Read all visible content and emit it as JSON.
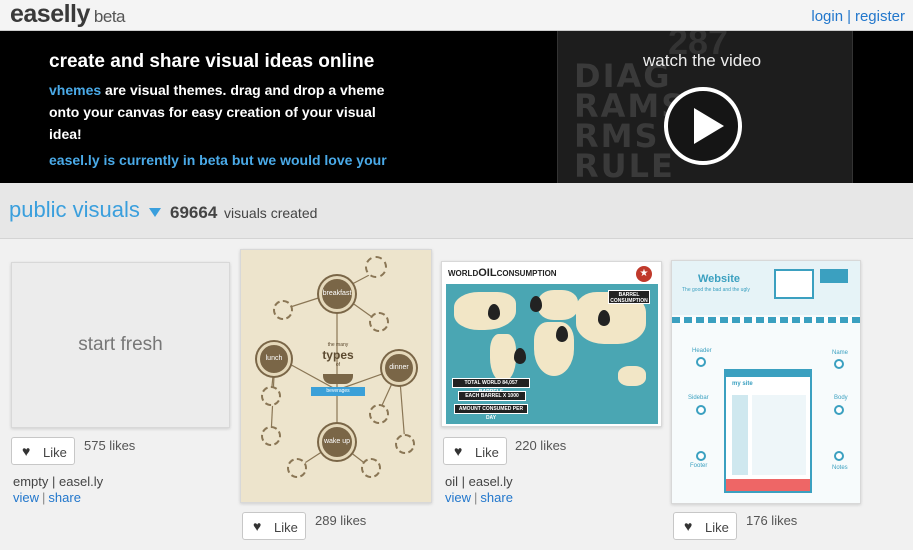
{
  "header": {
    "logo_text": "easelly",
    "beta_label": "beta",
    "login": "login",
    "separator": "|",
    "register": "register"
  },
  "hero": {
    "title": "create and share visual ideas online",
    "vhemes_word": "vhemes",
    "desc_rest": " are visual themes. drag and drop a vheme onto your canvas for easy creation of your visual idea!",
    "beta_note": "easel.ly is currently in beta but we would love your",
    "video_label": "watch the video"
  },
  "section": {
    "title": "public visuals",
    "count": "69664",
    "count_suffix": "visuals created"
  },
  "cards": [
    {
      "thumb_text": "start fresh",
      "like_label": "Like",
      "likes": "575 likes",
      "meta": "empty | easel.ly",
      "view": "view",
      "share": "share",
      "sep": "|"
    },
    {
      "like_label": "Like",
      "likes": "289 likes"
    },
    {
      "like_label": "Like",
      "likes": "220 likes",
      "meta": "oil | easel.ly",
      "view": "view",
      "share": "share",
      "sep": "|"
    },
    {
      "like_label": "Like",
      "likes": "176 likes"
    }
  ],
  "thumb_bev": {
    "center_line1": "the many",
    "center_line2": "types",
    "center_line3": "of",
    "banner": "beverages",
    "breakfast": "breakfast",
    "lunch": "lunch",
    "dinner": "dinner",
    "wake_up": "wake up"
  },
  "thumb_oil": {
    "title_world": "WORLD",
    "title_oil": "OIL",
    "title_consumption": "CONSUMPTION",
    "total": "TOTAL WORLD 84,057 BARRELS",
    "each": "EACH BARREL X 1000",
    "amount": "AMOUNT CONSUMED PER DAY",
    "legend": "BARREL CONSUMPTION"
  },
  "thumb_web": {
    "title": "Website",
    "subtitle": "The good the bad and the ugly",
    "my_site": "my site",
    "header": "Header",
    "sidebar": "Sidebar",
    "footer": "Footer",
    "name": "Name",
    "body": "Body",
    "notes": "Notes"
  },
  "colors": {
    "accent_blue": "#3a9fdd",
    "link_blue": "#2277cc",
    "hero_bg": "#000000"
  },
  "icons": {
    "like": "heart-icon",
    "play": "play-icon",
    "caret": "caret-down-icon"
  }
}
